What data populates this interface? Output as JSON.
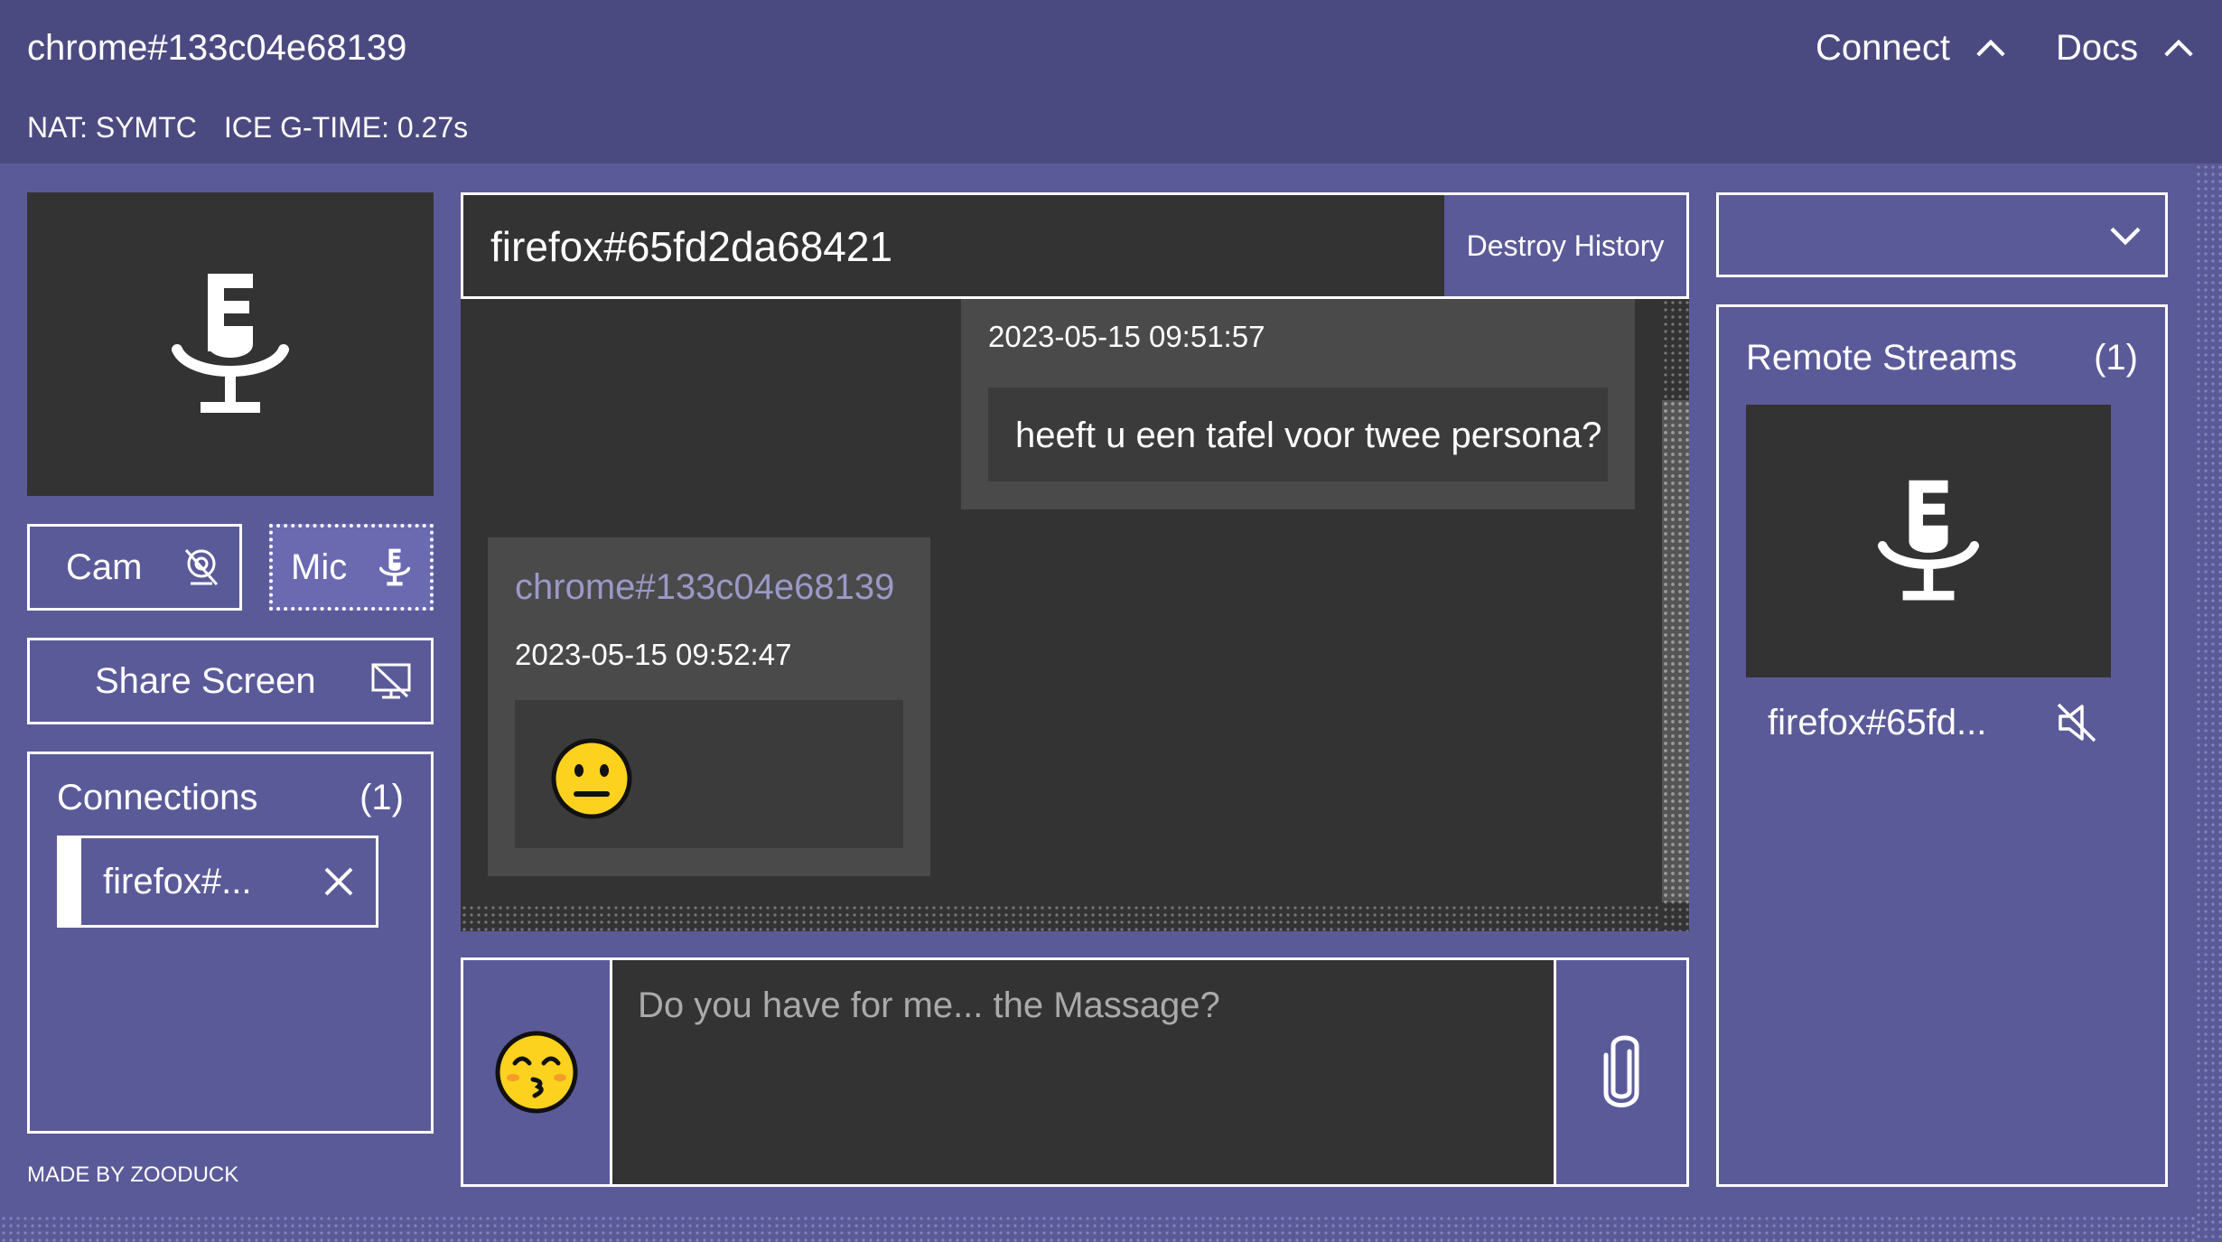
{
  "header": {
    "title": "chrome#133c04e68139",
    "nat": "NAT: SYMTC",
    "ice": "ICE G-TIME: 0.27s",
    "nav": [
      {
        "label": "Connect",
        "icon": "chevron-up-icon"
      },
      {
        "label": "Docs",
        "icon": "chevron-up-icon"
      }
    ]
  },
  "local": {
    "preview_icon": "microphone-icon",
    "cam_label": "Cam",
    "cam_icon": "camera-off-icon",
    "mic_label": "Mic",
    "mic_icon": "microphone-icon",
    "mic_active": true,
    "share_label": "Share Screen",
    "share_icon": "screen-share-off-icon"
  },
  "connections": {
    "title": "Connections",
    "count": "(1)",
    "items": [
      {
        "label": "firefox#...",
        "icon": "close-icon"
      }
    ]
  },
  "credit": "MADE BY ZOODUCK",
  "chat": {
    "peer": "firefox#65fd2da68421",
    "destroy_label": "Destroy History",
    "messages": [
      {
        "direction": "sent",
        "time": "2023-05-15 09:51:57",
        "text": "heeft u een tafel voor twee persona?"
      },
      {
        "direction": "received",
        "sender": "chrome#133c04e68139",
        "time": "2023-05-15 09:52:47",
        "emoji": "neutral-face"
      }
    ],
    "composer": {
      "emoji_icon": "kissing-smiling-eyes-emoji",
      "placeholder": "Do you have for me... the Massage?",
      "attach_icon": "paperclip-icon"
    }
  },
  "remote": {
    "select_icon": "chevron-down-icon",
    "title": "Remote Streams",
    "count": "(1)",
    "streams": [
      {
        "name": "firefox#65fd...",
        "icon": "microphone-icon",
        "muted_icon": "speaker-muted-icon"
      }
    ]
  },
  "colors": {
    "background": "#5b5a99",
    "header": "#4b4a80",
    "panel_dark": "#333333",
    "bubble": "#4a4a4a",
    "bubble_inner": "#3b3b3b",
    "sender_text": "#9a99c7",
    "emoji_yellow": "#fcd21e"
  }
}
